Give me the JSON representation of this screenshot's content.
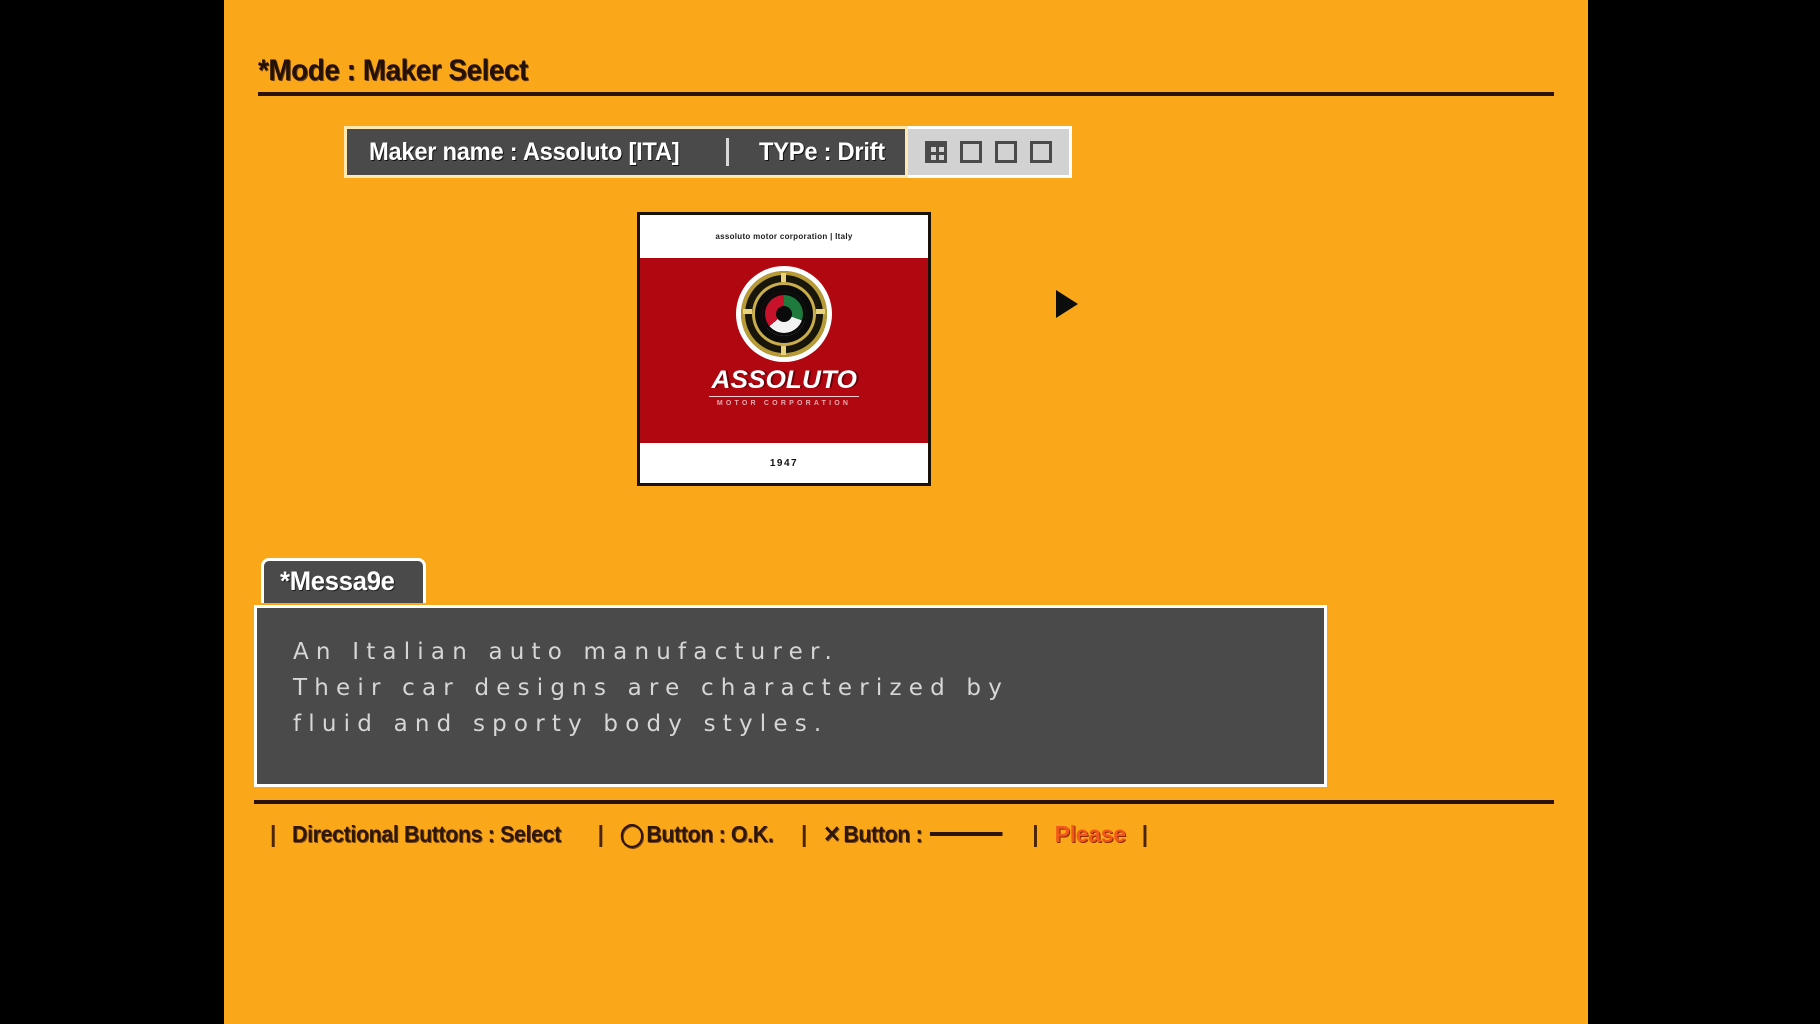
{
  "header": {
    "mode_title": "*Mode : Maker Select"
  },
  "info_bar": {
    "maker_label": "Maker name :",
    "maker_value": "Assoluto [ITA]",
    "maker_full": "Maker name :  Assoluto [ITA]",
    "type_full": "TYPe :  Drift",
    "type_label": "TYPe :",
    "type_value": "Drift",
    "separator": "|",
    "page_indicators": [
      {
        "state": "filled"
      },
      {
        "state": "empty"
      },
      {
        "state": "empty"
      },
      {
        "state": "empty"
      }
    ],
    "page_current": 1,
    "page_total": 4
  },
  "logo_card": {
    "corporation_line": "assoluto motor corporation | Italy",
    "wordmark": "ASSOLUTO",
    "wordmark_sub": "MOTOR CORPORATION",
    "year": "1947",
    "emblem_icon": "assoluto-circular-emblem",
    "colors": {
      "card_red": "#B00711",
      "flag_green": "#1F7A3D",
      "flag_white": "#F2F2F2",
      "flag_red": "#C8112A",
      "emblem_gold": "#C9AE4B"
    }
  },
  "next_arrow": {
    "icon": "triangle-right-icon"
  },
  "message": {
    "tab_label": "*Messa9e",
    "lines": [
      "An Italian auto manufacturer.",
      "Their car designs are characterized by",
      "fluid and sporty body styles."
    ]
  },
  "bottom_bar": {
    "pipe": "|",
    "items": [
      {
        "glyph": "",
        "text": "Directional Buttons : Select",
        "icon": "dpad-icon"
      },
      {
        "glyph": "◯",
        "text": "Button : O.K.",
        "icon": "circle-button-icon"
      },
      {
        "glyph": "✕",
        "text": "Button :",
        "icon": "cross-button-icon",
        "dash": true
      }
    ],
    "please_text": "Please",
    "please_color": "#F2581B"
  },
  "theme": {
    "background_orange": "#FAA81A",
    "letterbox_black": "#000000",
    "panel_gray": "#4A4A4A",
    "panel_border_white": "#FFFFFF",
    "dark_brown_text": "#2E1606"
  }
}
